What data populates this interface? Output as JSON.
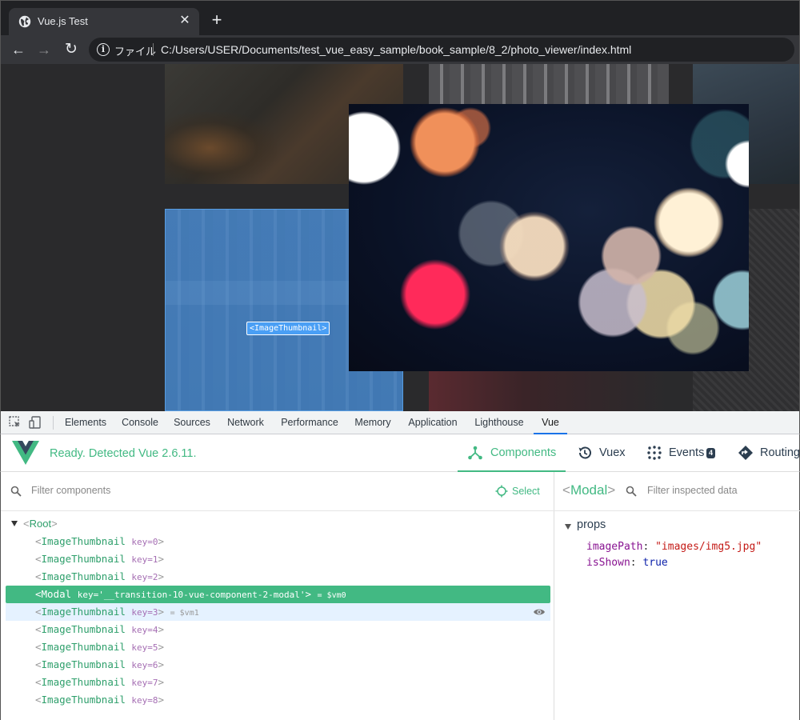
{
  "browser": {
    "tab_title": "Vue.js Test",
    "tab_close": "✕",
    "new_tab": "+",
    "scheme_label": "ファイル",
    "url": "C:/Users/USER/Documents/test_vue_easy_sample/book_sample/8_2/photo_viewer/index.html"
  },
  "page": {
    "highlight_label": "<ImageThumbnail>"
  },
  "devtools": {
    "tabs": [
      "Elements",
      "Console",
      "Sources",
      "Network",
      "Performance",
      "Memory",
      "Application",
      "Lighthouse",
      "Vue"
    ],
    "active_tab": "Vue"
  },
  "vue": {
    "status": "Ready. Detected Vue 2.6.11.",
    "tabs": [
      {
        "label": "Components",
        "icon": "tree-icon"
      },
      {
        "label": "Vuex",
        "icon": "history-icon"
      },
      {
        "label": "Events",
        "icon": "dots-icon",
        "badge": "4"
      },
      {
        "label": "Routing",
        "icon": "signpost-icon"
      }
    ],
    "filter_placeholder": "Filter components",
    "select_label": "Select",
    "tree": {
      "root": "Root",
      "rows": [
        {
          "name": "ImageThumbnail",
          "key": "key=0",
          "vm": ""
        },
        {
          "name": "ImageThumbnail",
          "key": "key=1",
          "vm": ""
        },
        {
          "name": "ImageThumbnail",
          "key": "key=2",
          "vm": ""
        },
        {
          "name": "Modal",
          "key": "key='__transition-10-vue-component-2-modal'",
          "vm": "= $vm0"
        },
        {
          "name": "ImageThumbnail",
          "key": "key=3",
          "vm": "= $vm1"
        },
        {
          "name": "ImageThumbnail",
          "key": "key=4",
          "vm": ""
        },
        {
          "name": "ImageThumbnail",
          "key": "key=5",
          "vm": ""
        },
        {
          "name": "ImageThumbnail",
          "key": "key=6",
          "vm": ""
        },
        {
          "name": "ImageThumbnail",
          "key": "key=7",
          "vm": ""
        },
        {
          "name": "ImageThumbnail",
          "key": "key=8",
          "vm": ""
        }
      ]
    },
    "inspector": {
      "component": "Modal",
      "filter_placeholder": "Filter inspected data",
      "section": "props",
      "props": [
        {
          "key": "imagePath",
          "value": "\"images/img5.jpg\""
        },
        {
          "key": "isShown",
          "value": "true"
        }
      ]
    },
    "colors": {
      "accent": "#42b983",
      "hover": "#e5f2ff",
      "key": "#a56eb3"
    }
  }
}
